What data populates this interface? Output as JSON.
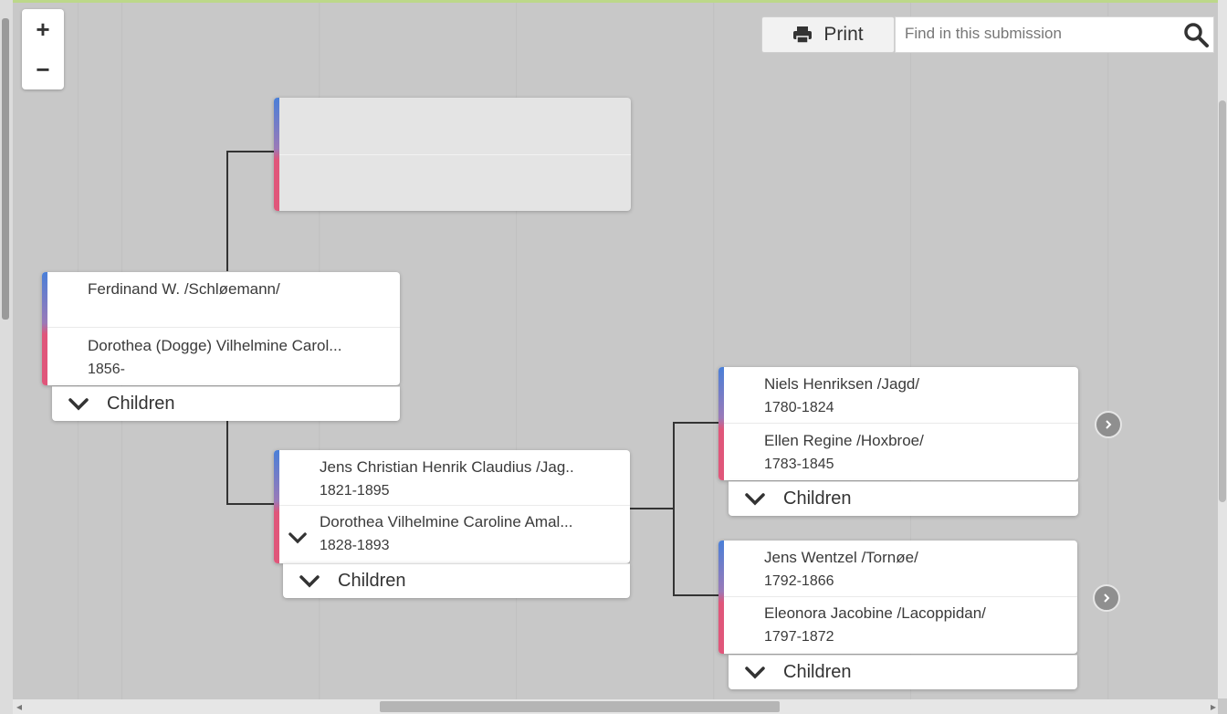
{
  "zoom": {
    "in_label": "+",
    "out_label": "−"
  },
  "toolbar": {
    "print_label": "Print",
    "search_placeholder": "Find in this submission"
  },
  "children_label": "Children",
  "family_a": {
    "husband": {
      "name": "Ferdinand W. /Schløemann/",
      "dates": ""
    },
    "wife": {
      "name": "Dorothea (Dogge) Vilhelmine Carol...",
      "dates": "1856-"
    }
  },
  "family_b": {
    "husband": {
      "name": "Jens Christian Henrik Claudius /Jag..",
      "dates": "1821-1895"
    },
    "wife": {
      "name": "Dorothea Vilhelmine Caroline Amal...",
      "dates": "1828-1893"
    }
  },
  "family_c": {
    "husband": {
      "name": "Niels Henriksen /Jagd/",
      "dates": "1780-1824"
    },
    "wife": {
      "name": "Ellen Regine /Hoxbroe/",
      "dates": "1783-1845"
    }
  },
  "family_d": {
    "husband": {
      "name": "Jens Wentzel /Tornøe/",
      "dates": "1792-1866"
    },
    "wife": {
      "name": "Eleonora Jacobine /Lacoppidan/",
      "dates": "1797-1872"
    }
  },
  "colors": {
    "male_accent": "#4a7fd8",
    "female_accent": "#e0567a",
    "connector": "#333333"
  },
  "icons": [
    "plus-icon",
    "minus-icon",
    "printer-icon",
    "search-icon",
    "chevron-down-icon",
    "chevron-right-circle-icon"
  ]
}
